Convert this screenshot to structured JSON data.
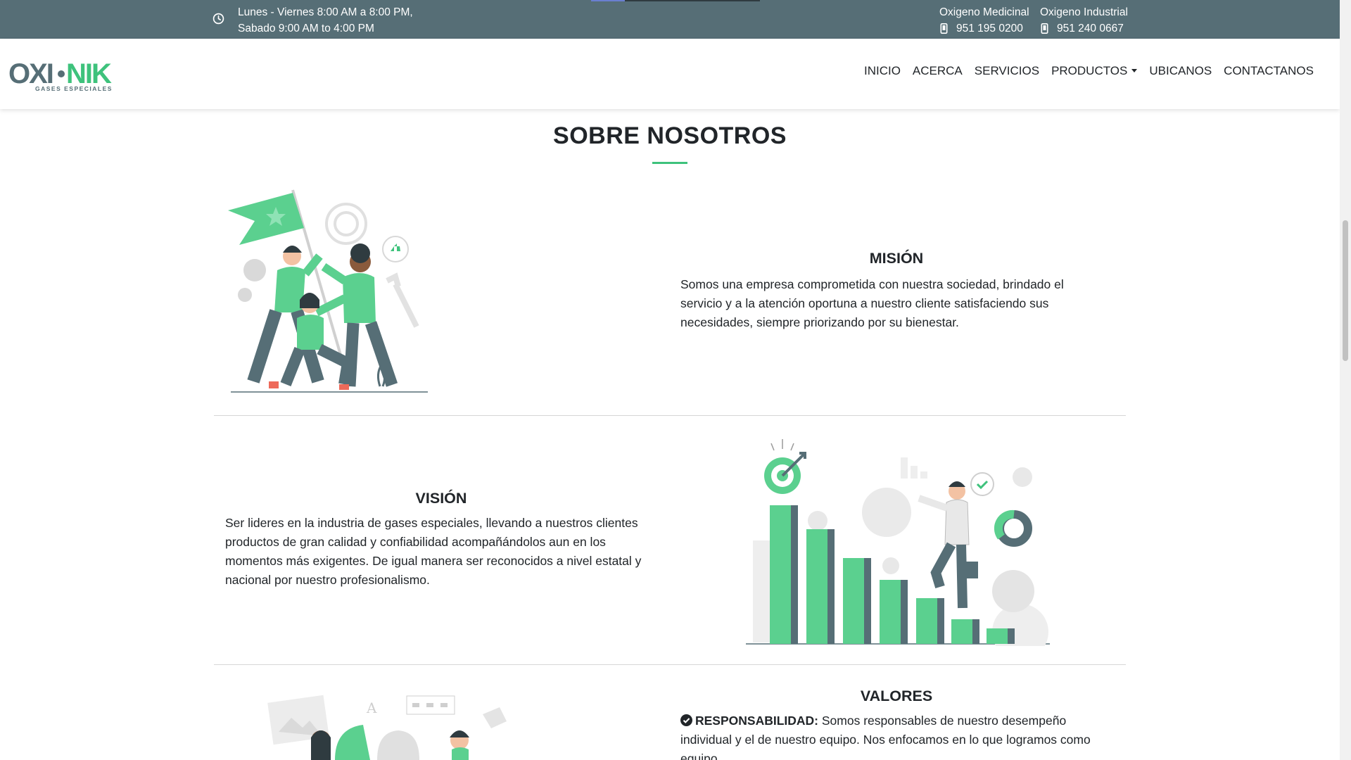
{
  "topbar": {
    "hours_line1": "Lunes - Viernes 8:00 AM a 8:00 PM,",
    "hours_line2": "Sabado 9:00 AM to 4:00 PM",
    "medicinal_label": "Oxigeno Medicinal",
    "medicinal_phone": "951 195 0200",
    "industrial_label": "Oxigeno Industrial",
    "industrial_phone": "951 240 0667",
    "icons": [
      "clock-icon",
      "phone-icon"
    ]
  },
  "brand": {
    "logo_text_left": "OXI",
    "logo_text_right": "NIK",
    "logo_tagline": "GASES ESPECIALES",
    "colors": {
      "dark": "#566e76",
      "green": "#3ec27c"
    }
  },
  "nav": {
    "items": [
      "INICIO",
      "ACERCA",
      "SERVICIOS",
      "PRODUCTOS",
      "UBICANOS",
      "CONTACTANOS"
    ]
  },
  "about": {
    "title": "SOBRE NOSOTROS",
    "mision": {
      "heading": "MISIÓN",
      "text": "Somos una empresa comprometida con nuestra sociedad, brindado el servicio y a la atención oportuna a nuestro cliente satisfaciendo sus necesidades, siempre priorizando por su bienestar."
    },
    "vision": {
      "heading": "VISIÓN",
      "text": "Ser lideres en la industria de gases especiales, llevando a nuestros clientes productos de gran calidad y confiabilidad acompañándolos aun en los momentos más exigentes. De igual manera ser reconocidos a nivel estatal y nacional por nuestro profesionalismo."
    },
    "valores": {
      "heading": "VALORES",
      "item1_label": "RESPONSABILIDAD:",
      "item1_text": " Somos responsables de nuestro desempeño individual y el de nuestro equipo. Nos enfocamos en lo que logramos como equipo."
    }
  }
}
